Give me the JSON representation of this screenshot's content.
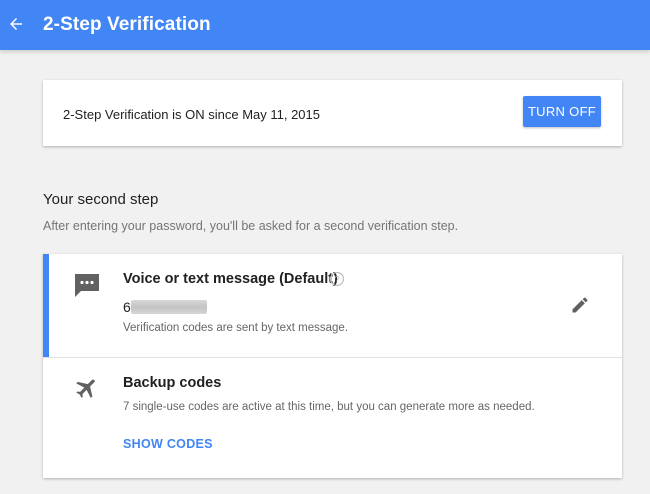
{
  "topbar": {
    "title": "2-Step Verification",
    "back_icon": "arrow-back-icon",
    "color": "#4285f4"
  },
  "status_card": {
    "text": "2-Step Verification is ON since May 11, 2015",
    "button_label": "TURN OFF"
  },
  "second_step": {
    "heading": "Your second step",
    "description": "After entering your password, you'll be asked for a second verification step."
  },
  "methods": {
    "voice": {
      "icon": "message-icon",
      "title": "Voice or text message (Default)",
      "help_icon": "help-circle-icon",
      "phone_prefix": "6",
      "description": "Verification codes are sent by text message.",
      "edit_icon": "pencil-icon"
    },
    "backup": {
      "icon": "airplane-icon",
      "title": "Backup codes",
      "description": "7 single-use codes are active at this time, but you can generate more as needed.",
      "action_label": "SHOW CODES"
    }
  },
  "colors": {
    "accent": "#4285f4",
    "background": "#f1f1f1",
    "icon": "#616161"
  }
}
